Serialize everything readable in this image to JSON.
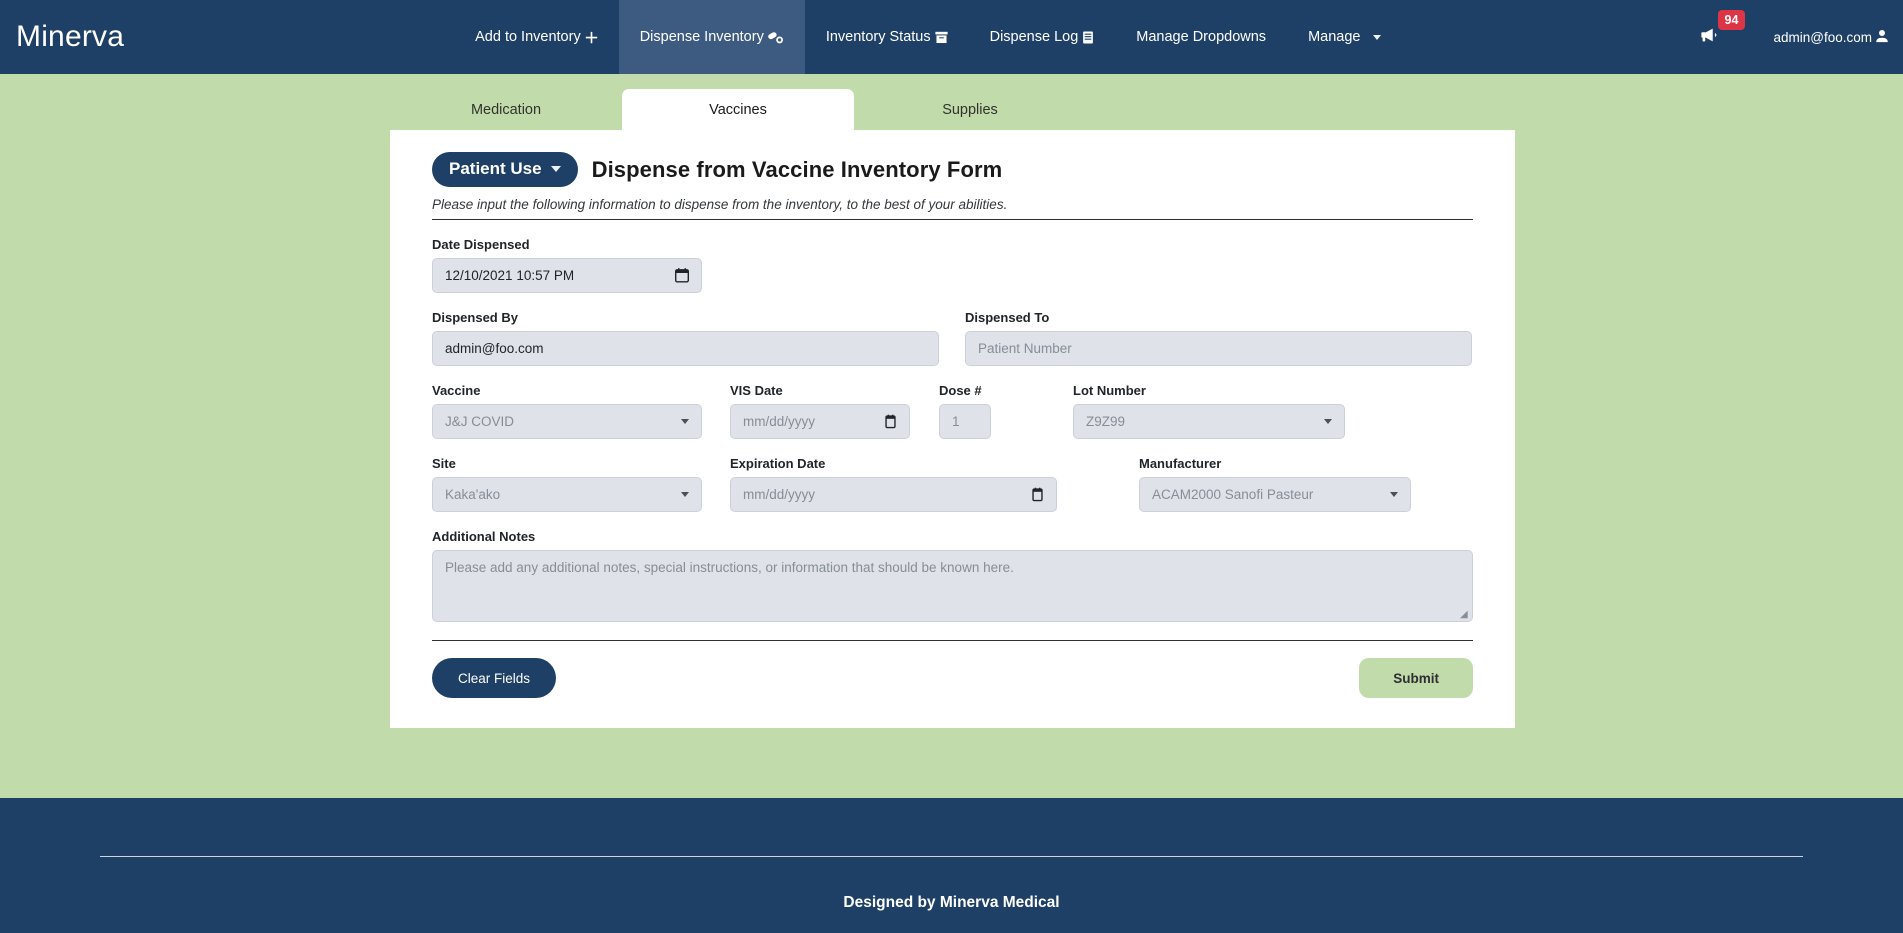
{
  "navbar": {
    "brand": "Minerva",
    "items": [
      {
        "label": "Add to Inventory",
        "icon": "plus-icon",
        "active": false
      },
      {
        "label": "Dispense Inventory",
        "icon": "pills-icon",
        "active": true
      },
      {
        "label": "Inventory Status",
        "icon": "archive-box-icon",
        "active": false
      },
      {
        "label": "Dispense Log",
        "icon": "list-log-icon",
        "active": false
      },
      {
        "label": "Manage Dropdowns",
        "icon": "",
        "active": false
      },
      {
        "label": "Manage",
        "icon": "chevron-down-icon",
        "active": false
      }
    ],
    "announcements": {
      "icon": "megaphone-icon",
      "badge_count": "94",
      "badge_color": "#dc3545"
    },
    "user": {
      "email": "admin@foo.com",
      "icon": "user-icon"
    }
  },
  "tabs": [
    {
      "label": "Medication",
      "active": false
    },
    {
      "label": "Vaccines",
      "active": true
    },
    {
      "label": "Supplies",
      "active": false
    }
  ],
  "form": {
    "patient_use_button": "Patient Use",
    "patient_use_caret": "caret-down-icon",
    "title": "Dispense from Vaccine Inventory Form",
    "subtitle": "Please input the following information to dispense from the inventory, to the best of your abilities.",
    "fields": {
      "date_dispensed": {
        "label": "Date Dispensed",
        "value": "12/10/2021 10:57 PM",
        "icon": "calendar-icon"
      },
      "dispensed_by": {
        "label": "Dispensed By",
        "value": "admin@foo.com",
        "placeholder": ""
      },
      "dispensed_to": {
        "label": "Dispensed To",
        "value": "",
        "placeholder": "Patient Number"
      },
      "vaccine": {
        "label": "Vaccine",
        "value": "J&J COVID",
        "icon": "caret-down-icon"
      },
      "vis_date": {
        "label": "VIS Date",
        "value": "mm/dd/yyyy",
        "icon": "calendar-icon"
      },
      "dose_number": {
        "label": "Dose #",
        "value": "1",
        "placeholder": "1"
      },
      "lot_number": {
        "label": "Lot Number",
        "value": "Z9Z99",
        "icon": "caret-down-icon"
      },
      "site": {
        "label": "Site",
        "value": "Kaka'ako",
        "icon": "caret-down-icon"
      },
      "expiration_date": {
        "label": "Expiration Date",
        "value": "mm/dd/yyyy",
        "icon": "calendar-icon"
      },
      "manufacturer": {
        "label": "Manufacturer",
        "value": "ACAM2000 Sanofi Pasteur",
        "icon": "caret-down-icon"
      },
      "additional_notes": {
        "label": "Additional Notes",
        "value": "",
        "placeholder": "Please add any additional notes, special instructions, or information that should be known here."
      }
    },
    "buttons": {
      "clear": "Clear Fields",
      "submit": "Submit"
    }
  },
  "footer": {
    "text": "Designed by Minerva Medical"
  },
  "colors": {
    "navy": "#1e3f66",
    "navy_active": "#3d5b80",
    "green_bg": "#c2dbaa",
    "field_bg": "#dfe2e9",
    "badge_red": "#dc3545"
  }
}
